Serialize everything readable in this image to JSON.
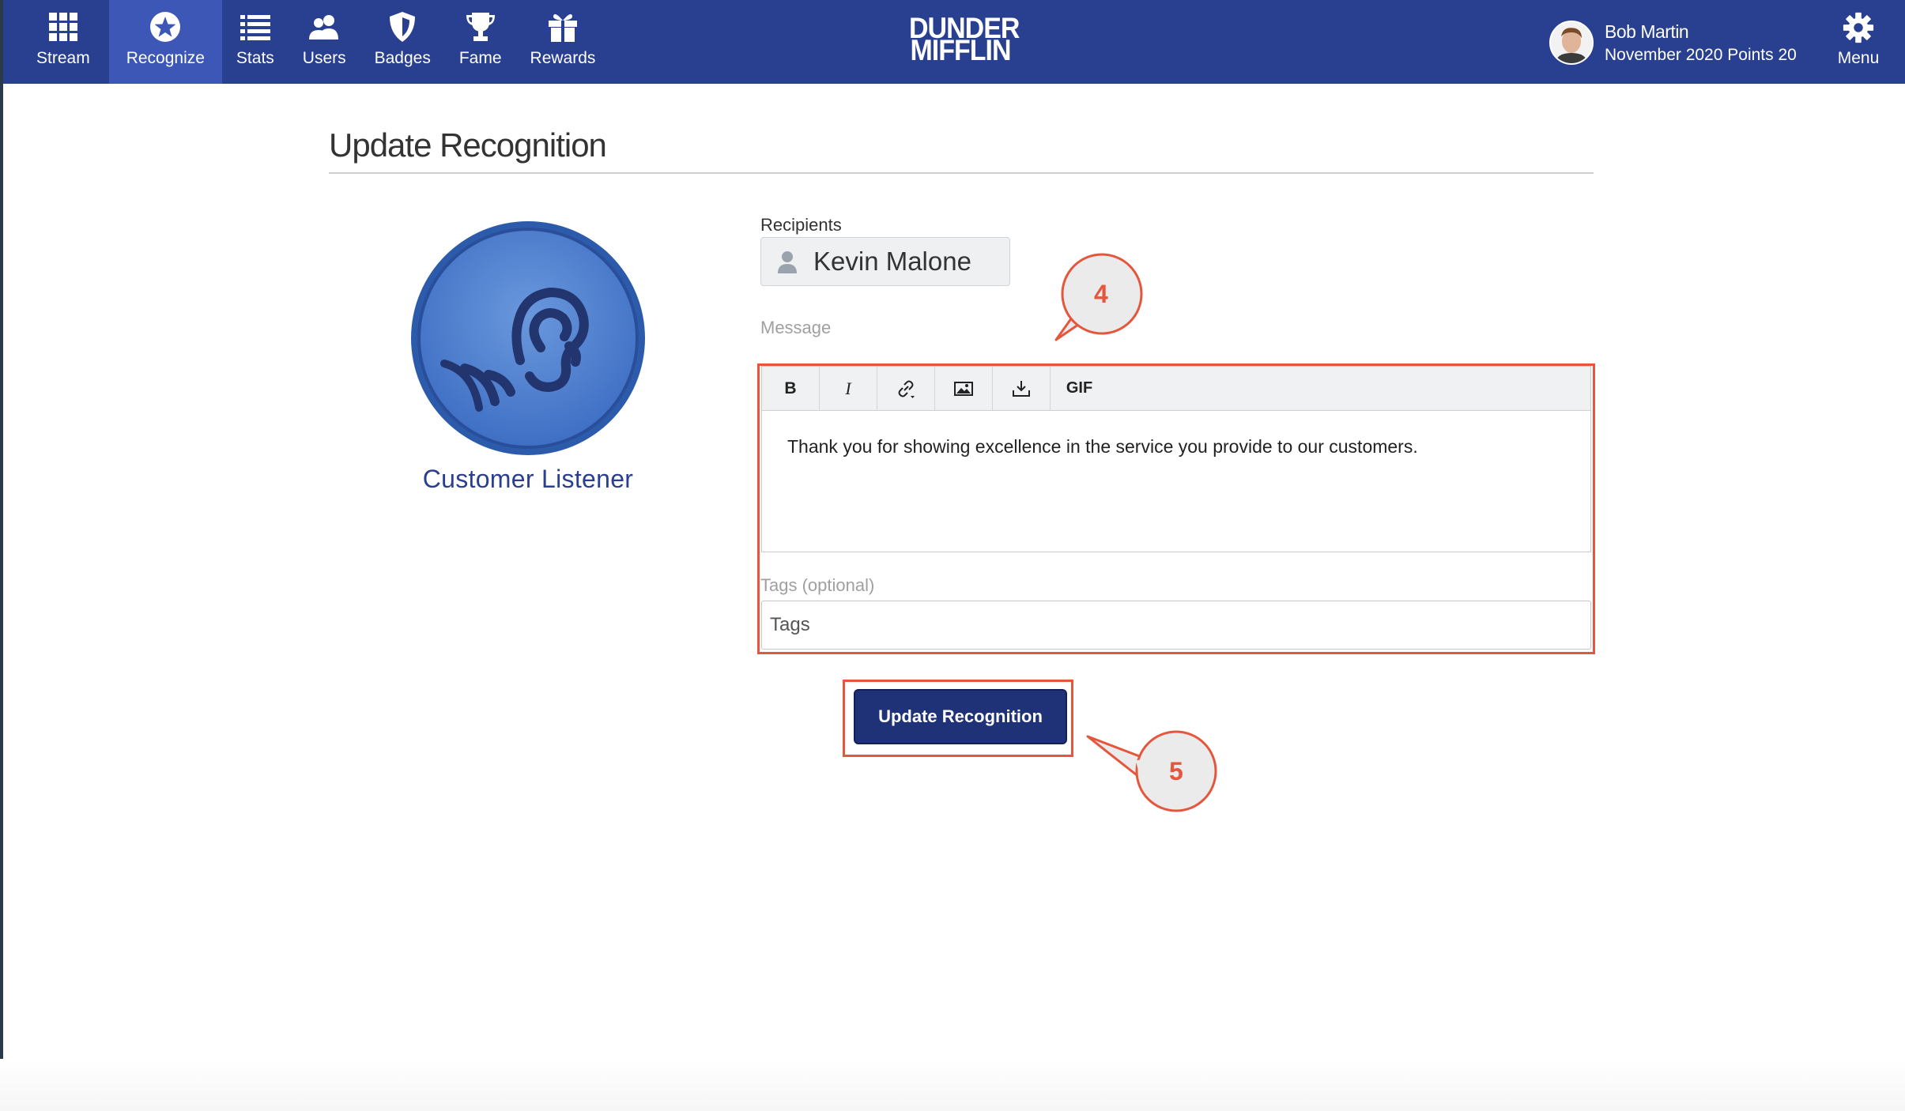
{
  "nav": {
    "items": [
      {
        "id": "stream",
        "label": "Stream",
        "icon": "grid-icon"
      },
      {
        "id": "recognize",
        "label": "Recognize",
        "icon": "star-circle-icon",
        "active": true
      },
      {
        "id": "stats",
        "label": "Stats",
        "icon": "list-icon"
      },
      {
        "id": "users",
        "label": "Users",
        "icon": "users-icon"
      },
      {
        "id": "badges",
        "label": "Badges",
        "icon": "shield-icon"
      },
      {
        "id": "fame",
        "label": "Fame",
        "icon": "trophy-icon"
      },
      {
        "id": "rewards",
        "label": "Rewards",
        "icon": "gift-icon"
      }
    ],
    "brand_line1": "DUNDER",
    "brand_line2": "MIFFLIN",
    "user_name": "Bob Martin",
    "user_points": "November 2020 Points 20",
    "menu_label": "Menu",
    "color": "#293f8f",
    "active_color": "#3c57b5"
  },
  "page": {
    "title": "Update Recognition"
  },
  "badge": {
    "name": "Customer Listener",
    "icon": "ear-sound-icon"
  },
  "form": {
    "recipients_label": "Recipients",
    "recipient_name": "Kevin Malone",
    "message_label": "Message",
    "toolbar": {
      "bold": "B",
      "italic": "I",
      "gif": "GIF"
    },
    "message_text": "Thank you for showing excellence in the service you provide to our customers.",
    "tags_label": "Tags (optional)",
    "tags_placeholder": "Tags",
    "submit_label": "Update Recognition"
  },
  "annotations": {
    "callout_4": "4",
    "callout_5": "5",
    "highlight_color": "#e4573d"
  }
}
